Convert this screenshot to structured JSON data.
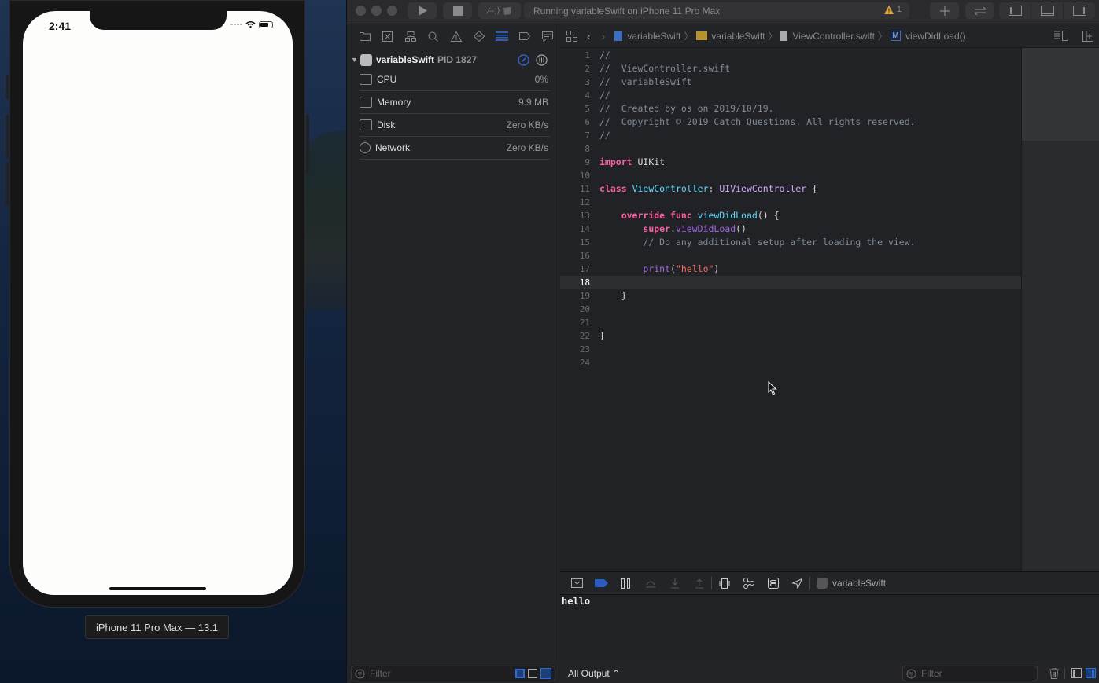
{
  "simulator": {
    "status_time": "2:41",
    "device_label": "iPhone 11 Pro Max — 13.1"
  },
  "toolbar": {
    "activity_text": "Running variableSwift on iPhone 11 Pro Max",
    "warning_count": "1",
    "scheme_icon": "swift-scheme-icon"
  },
  "navigator": {
    "process_name": "variableSwift",
    "pid_label": "PID 1827",
    "gauges": [
      {
        "label": "CPU",
        "value": "0%"
      },
      {
        "label": "Memory",
        "value": "9.9 MB"
      },
      {
        "label": "Disk",
        "value": "Zero KB/s"
      },
      {
        "label": "Network",
        "value": "Zero KB/s"
      }
    ],
    "filter_placeholder": "Filter"
  },
  "jumpbar": {
    "crumbs": [
      "variableSwift",
      "variableSwift",
      "ViewController.swift",
      "viewDidLoad()"
    ]
  },
  "editor": {
    "current_line": 18,
    "lines": [
      {
        "n": "1",
        "html": "<span class=\"cm\">//</span>"
      },
      {
        "n": "2",
        "html": "<span class=\"cm\">//  ViewController.swift</span>"
      },
      {
        "n": "3",
        "html": "<span class=\"cm\">//  variableSwift</span>"
      },
      {
        "n": "4",
        "html": "<span class=\"cm\">//</span>"
      },
      {
        "n": "5",
        "html": "<span class=\"cm\">//  Created by os on 2019/10/19.</span>"
      },
      {
        "n": "6",
        "html": "<span class=\"cm\">//  Copyright © 2019 Catch Questions. All rights reserved.</span>"
      },
      {
        "n": "7",
        "html": "<span class=\"cm\">//</span>"
      },
      {
        "n": "8",
        "html": ""
      },
      {
        "n": "9",
        "html": "<span class=\"kw\">import</span> UIKit"
      },
      {
        "n": "10",
        "html": ""
      },
      {
        "n": "11",
        "html": "<span class=\"kw\">class</span> <span class=\"ty\">ViewController</span>: <span class=\"ty2\">UIViewController</span> {"
      },
      {
        "n": "12",
        "html": ""
      },
      {
        "n": "13",
        "html": "    <span class=\"kw\">override</span> <span class=\"kw\">func</span> <span class=\"ty\">viewDidLoad</span>() {"
      },
      {
        "n": "14",
        "html": "        <span class=\"kw\" style=\"color:#fc5fa3\">super</span>.<span class=\"lib\">viewDidLoad</span>()"
      },
      {
        "n": "15",
        "html": "        <span class=\"cm\">// Do any additional setup after loading the view.</span>"
      },
      {
        "n": "16",
        "html": ""
      },
      {
        "n": "17",
        "html": "        <span class=\"lib\">print</span>(<span class=\"str\">\"hello\"</span>)"
      },
      {
        "n": "18",
        "html": ""
      },
      {
        "n": "19",
        "html": "    }"
      },
      {
        "n": "20",
        "html": ""
      },
      {
        "n": "21",
        "html": ""
      },
      {
        "n": "22",
        "html": "}"
      },
      {
        "n": "23",
        "html": ""
      },
      {
        "n": "24",
        "html": ""
      }
    ]
  },
  "debug": {
    "target_name": "variableSwift",
    "console_output": "hello",
    "output_selector": "All Output ⌃",
    "filter_placeholder": "Filter"
  }
}
